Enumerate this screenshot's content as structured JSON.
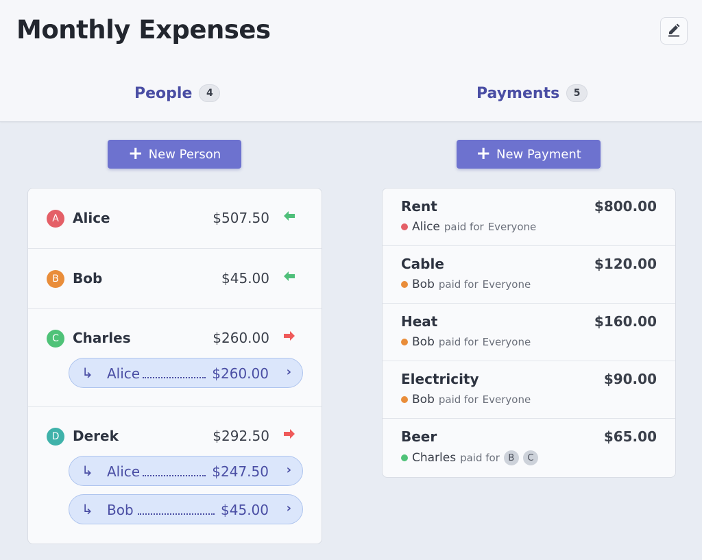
{
  "header": {
    "title": "Monthly Expenses",
    "edit_icon": "pencil-icon"
  },
  "tabs": [
    {
      "label": "People",
      "count": "4"
    },
    {
      "label": "Payments",
      "count": "5"
    }
  ],
  "people_section": {
    "new_button_label": "New Person",
    "people": [
      {
        "initial": "A",
        "name": "Alice",
        "amount": "$507.50",
        "direction": "receives",
        "color": "#e45f67",
        "debts": []
      },
      {
        "initial": "B",
        "name": "Bob",
        "amount": "$45.00",
        "direction": "receives",
        "color": "#e98d3a",
        "debts": []
      },
      {
        "initial": "C",
        "name": "Charles",
        "amount": "$260.00",
        "direction": "owes",
        "color": "#4fc278",
        "debts": [
          {
            "to": "Alice",
            "amount": "$260.00"
          }
        ]
      },
      {
        "initial": "D",
        "name": "Derek",
        "amount": "$292.50",
        "direction": "owes",
        "color": "#3fb2aa",
        "debts": [
          {
            "to": "Alice",
            "amount": "$247.50"
          },
          {
            "to": "Bob",
            "amount": "$45.00"
          }
        ]
      }
    ]
  },
  "payments_section": {
    "new_button_label": "New Payment",
    "paid_for_text": "paid for",
    "payments": [
      {
        "title": "Rent",
        "amount": "$800.00",
        "payer": "Alice",
        "payer_color": "#e45f67",
        "for_text": "Everyone"
      },
      {
        "title": "Cable",
        "amount": "$120.00",
        "payer": "Bob",
        "payer_color": "#e98d3a",
        "for_text": "Everyone"
      },
      {
        "title": "Heat",
        "amount": "$160.00",
        "payer": "Bob",
        "payer_color": "#e98d3a",
        "for_text": "Everyone"
      },
      {
        "title": "Electricity",
        "amount": "$90.00",
        "payer": "Bob",
        "payer_color": "#e98d3a",
        "for_text": "Everyone"
      },
      {
        "title": "Beer",
        "amount": "$65.00",
        "payer": "Charles",
        "payer_color": "#4fc278",
        "for_chips": [
          "B",
          "C"
        ]
      }
    ]
  },
  "colors": {
    "accent": "#6d72cf",
    "tab_text": "#4a4ea4",
    "receive_arrow": "#4fbf7a",
    "owe_arrow": "#ef5a5a"
  }
}
